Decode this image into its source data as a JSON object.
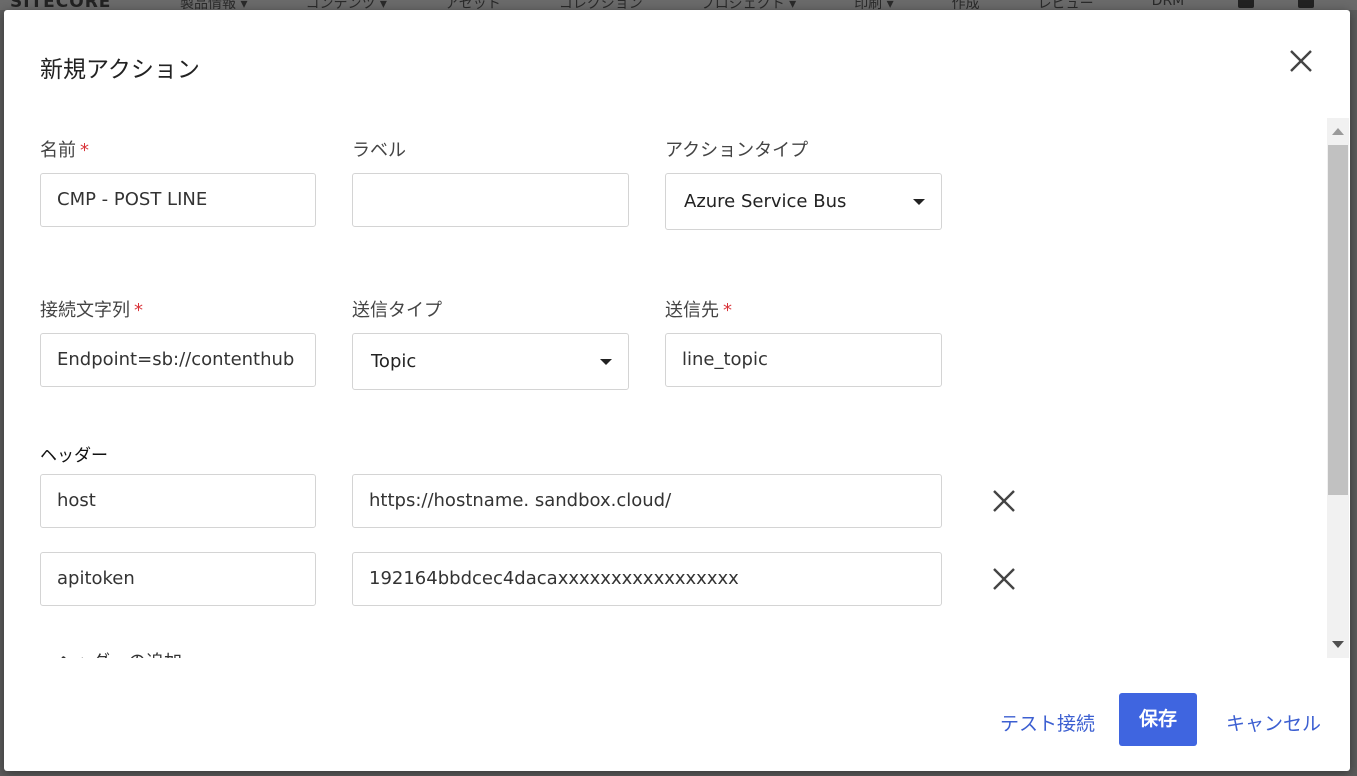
{
  "background": {
    "logo": "SITECORE",
    "nav": [
      "製品情報 ▾",
      "コンテンツ ▾",
      "アセット",
      "コレクション",
      "プロジェクト ▾",
      "印刷 ▾",
      "作成",
      "レビュー",
      "DRM"
    ]
  },
  "modal": {
    "title": "新規アクション",
    "close_icon": "close-icon"
  },
  "form": {
    "name": {
      "label": "名前",
      "required": "*",
      "value": "CMP - POST LINE"
    },
    "display_label": {
      "label": "ラベル",
      "value": ""
    },
    "action_type": {
      "label": "アクションタイプ",
      "value": "Azure Service Bus"
    },
    "connection_string": {
      "label": "接続文字列",
      "required": "*",
      "value": "Endpoint=sb://contenthub"
    },
    "send_type": {
      "label": "送信タイプ",
      "value": "Topic"
    },
    "destination": {
      "label": "送信先",
      "required": "*",
      "value": "line_topic"
    },
    "headers_label": "ヘッダー",
    "headers": [
      {
        "key": "host",
        "value": "https://hostname. sandbox.cloud/"
      },
      {
        "key": "apitoken",
        "value": "192164bbdcec4dacaxxxxxxxxxxxxxxxxx"
      }
    ],
    "add_header": "ヘッダーの追加"
  },
  "footer": {
    "test_connection": "テスト接続",
    "save": "保存",
    "cancel": "キャンセル"
  },
  "colors": {
    "primary": "#3f65e0",
    "link": "#3c5fd1",
    "required": "#d9343a"
  }
}
